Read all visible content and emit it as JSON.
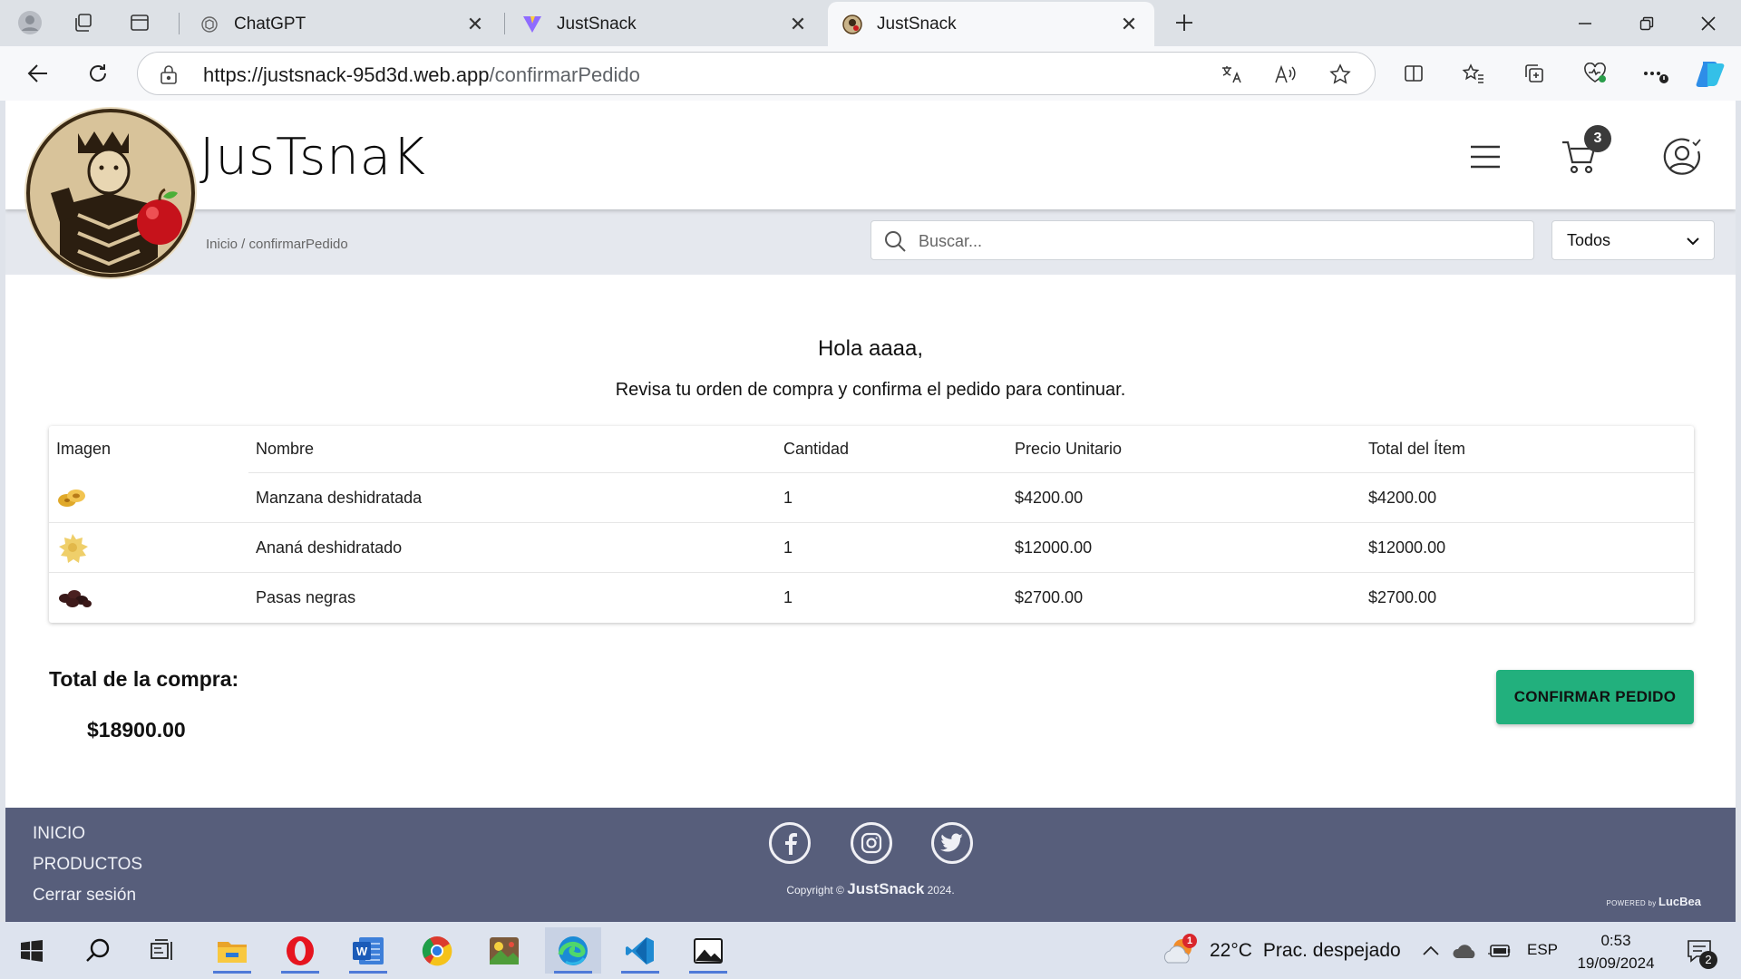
{
  "browser": {
    "tabs": [
      {
        "title": "ChatGPT"
      },
      {
        "title": "JustSnack"
      },
      {
        "title": "JustSnack"
      }
    ],
    "url_host": "https://justsnack-95d3d.web.app",
    "url_path": "/confirmarPedido"
  },
  "site": {
    "brand": "JusTsnaK",
    "cart_count": "3",
    "breadcrumb": "Inicio / confirmarPedido",
    "search_placeholder": "Buscar...",
    "category_selected": "Todos"
  },
  "order": {
    "greeting": "Hola aaaa,",
    "subtitle": "Revisa tu orden de compra y confirma el pedido para continuar.",
    "columns": [
      "Imagen",
      "Nombre",
      "Cantidad",
      "Precio Unitario",
      "Total del Ítem"
    ],
    "items": [
      {
        "name": "Manzana deshidratada",
        "qty": "1",
        "unit": "$4200.00",
        "total": "$4200.00"
      },
      {
        "name": "Ananá deshidratado",
        "qty": "1",
        "unit": "$12000.00",
        "total": "$12000.00"
      },
      {
        "name": "Pasas negras",
        "qty": "1",
        "unit": "$2700.00",
        "total": "$2700.00"
      }
    ],
    "total_label": "Total de la compra:",
    "total_value": "$18900.00",
    "confirm_label": "CONFIRMAR PEDIDO"
  },
  "footer": {
    "links": [
      "INICIO",
      "PRODUCTOS",
      "Cerrar sesión"
    ],
    "copyright_prefix": "Copyright ©",
    "copyright_brand": "JustSnack",
    "copyright_year": "2024.",
    "powered_prefix": "POWERED by",
    "powered_brand": "LucBea"
  },
  "taskbar": {
    "temperature": "22°C",
    "weather": "Prac. despejado",
    "weather_badge": "1",
    "language": "ESP",
    "time": "0:53",
    "date": "19/09/2024",
    "notifications": "2"
  },
  "colors": {
    "confirm_button": "#22b07d",
    "footer_bg": "#575e7b",
    "subbar_bg": "#e5e8ee"
  }
}
